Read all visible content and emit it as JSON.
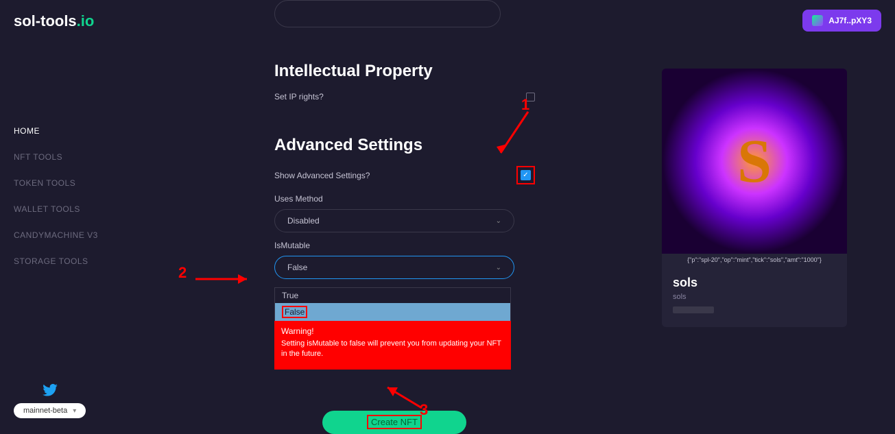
{
  "brand": {
    "name": "sol-tools",
    "suffix": ".io"
  },
  "nav": {
    "home": "HOME",
    "nft_tools": "NFT TOOLS",
    "token_tools": "TOKEN TOOLS",
    "wallet_tools": "WALLET TOOLS",
    "candymachine": "CANDYMACHINE V3",
    "storage_tools": "STORAGE TOOLS"
  },
  "network": "mainnet-beta",
  "wallet_address": "AJ7f..pXY3",
  "sections": {
    "ip_title": "Intellectual Property",
    "ip_label": "Set IP rights?",
    "adv_title": "Advanced Settings",
    "adv_label": "Show Advanced Settings?",
    "uses_method_label": "Uses Method",
    "uses_method_value": "Disabled",
    "ismutable_label": "IsMutable",
    "ismutable_value": "False",
    "dropdown_option_true": "True",
    "dropdown_option_false": "False",
    "warning_title": "Warning!",
    "warning_text": "Setting isMutable to false will prevent you from updating your NFT in the future.",
    "create_btn": "Create NFT"
  },
  "preview": {
    "title": "sols",
    "subtitle": "sols",
    "meta": "{\"p\":\"spl-20\",\"op\":\"mint\",\"tick\":\"sols\",\"amt\":\"1000\"}"
  },
  "annotations": {
    "one": "1",
    "two": "2",
    "three": "3"
  }
}
